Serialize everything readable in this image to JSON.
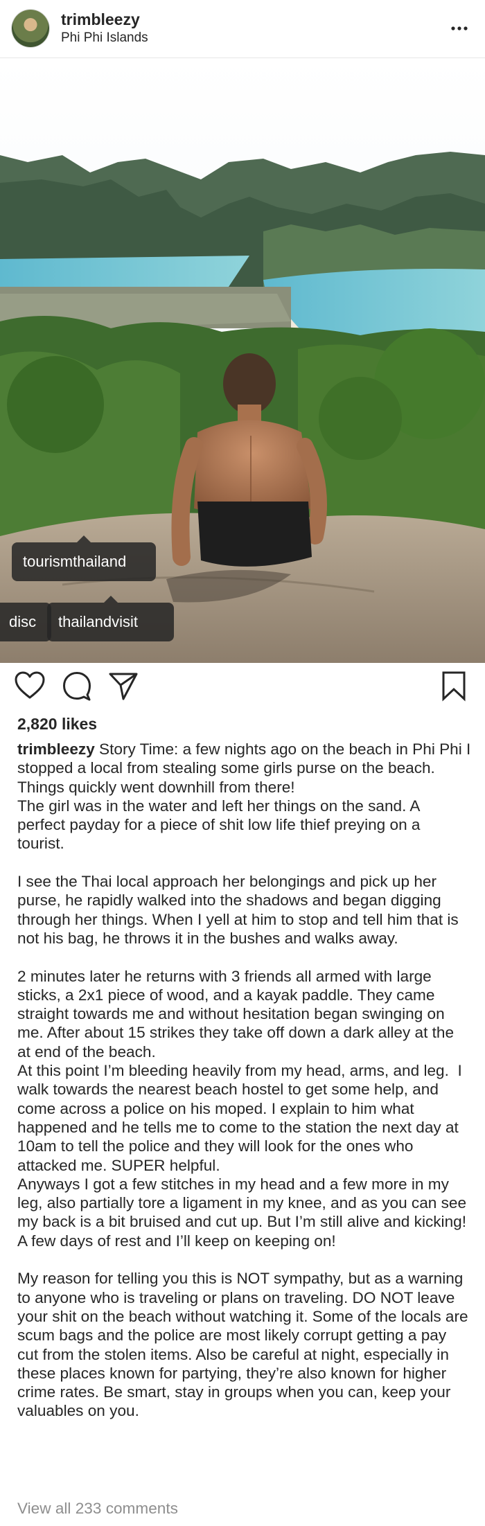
{
  "post": {
    "username": "trimbleezy",
    "location": "Phi Phi Islands",
    "likes": "2,820 likes",
    "view_comments": "View all 233 comments"
  },
  "tags": {
    "tag1": "tourismthailand",
    "tag2": "thailandvisit",
    "tag_partial": "disc"
  },
  "caption": {
    "user": "trimbleezy",
    "text": " Story Time: a few nights ago on the beach in Phi Phi I stopped a local from stealing some girls purse on the beach. Things quickly went downhill from there!\nThe girl was in the water and left her things on the sand. A perfect payday for a piece of shit low life thief preying on a tourist.\n\nI see the Thai local approach her belongings and pick up her purse, he rapidly walked into the shadows and began digging through her things. When I yell at him to stop and tell him that is not his bag, he throws it in the bushes and walks away.\n\n2 minutes later he returns with 3 friends all armed with large sticks, a 2x1 piece of wood, and a kayak paddle. They came straight towards me and without hesitation began swinging on me. After about 15 strikes they take off down a dark alley at the at end of the beach.\nAt this point I’m bleeding heavily from my head, arms, and leg.  I walk towards the nearest beach hostel to get some help, and come across a police on his moped. I explain to him what happened and he tells me to come to the station the next day at 10am to tell the police and they will look for the ones who attacked me. SUPER helpful.\nAnyways I got a few stitches in my head and a few more in my leg, also partially tore a ligament in my knee, and as you can see my back is a bit bruised and cut up. But I’m still alive and kicking! A few days of rest and I’ll keep on keeping on!\n\nMy reason for telling you this is NOT sympathy, but as a warning to anyone who is traveling or plans on traveling. DO NOT leave your shit on the beach without watching it. Some of the locals are scum bags and the police are most likely corrupt getting a pay cut from the stolen items. Also be careful at night, especially in these places known for partying, they’re also known for higher crime rates. Be smart, stay in groups when you can, keep your valuables on you."
  },
  "icons": {
    "more": "more-dots-icon",
    "like": "heart-icon",
    "comment": "comment-bubble-icon",
    "share": "paper-plane-icon",
    "save": "bookmark-icon"
  },
  "colors": {
    "text": "#262626",
    "muted": "#8e8e8e",
    "tag_bg": "#262626"
  }
}
